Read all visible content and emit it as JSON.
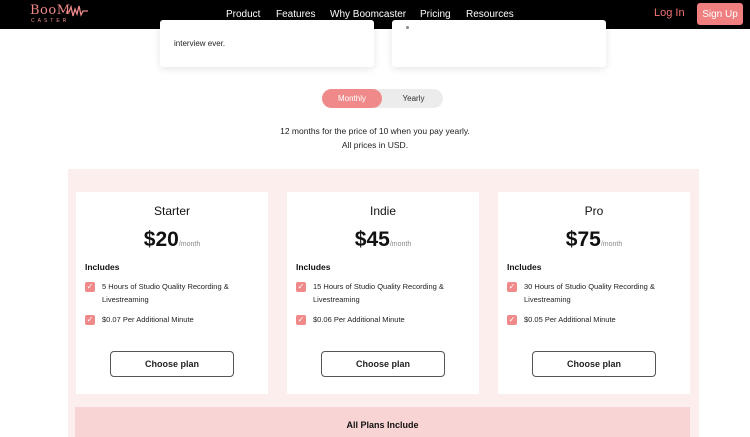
{
  "brand": {
    "logo_main": "BooM",
    "logo_sub": "CASTER",
    "accent": "#f08a8a"
  },
  "nav": {
    "links": [
      "Product",
      "Features",
      "Why Boomcaster",
      "Pricing",
      "Resources"
    ],
    "login": "Log In",
    "signup": "Sign Up"
  },
  "top_cards": {
    "fragment": "interview ever."
  },
  "toggle": {
    "monthly": "Monthly",
    "yearly": "Yearly",
    "selected": "Monthly"
  },
  "notes": {
    "line1": "12 months for the price of 10 when you pay yearly.",
    "line2": "All prices in USD."
  },
  "plans": [
    {
      "name": "Starter",
      "price": "$20",
      "per": "/month",
      "includes": "Includes",
      "features": [
        "5 Hours of Studio Quality Recording &",
        "Livestreaming",
        "$0.07 Per Additional Minute"
      ],
      "cta": "Choose plan"
    },
    {
      "name": "Indie",
      "price": "$45",
      "per": "/month",
      "includes": "Includes",
      "features": [
        "15 Hours of Studio Quality Recording &",
        "Livestreaming",
        "$0.06 Per Additional Minute"
      ],
      "cta": "Choose plan"
    },
    {
      "name": "Pro",
      "price": "$75",
      "per": "/month",
      "includes": "Includes",
      "features": [
        "30 Hours of Studio Quality Recording &",
        "Livestreaming",
        "$0.05 Per Additional Minute"
      ],
      "cta": "Choose plan"
    }
  ],
  "all_plans": {
    "title": "All Plans Include"
  },
  "icons": {
    "check": "check-icon",
    "wave": "sound-wave-icon"
  }
}
